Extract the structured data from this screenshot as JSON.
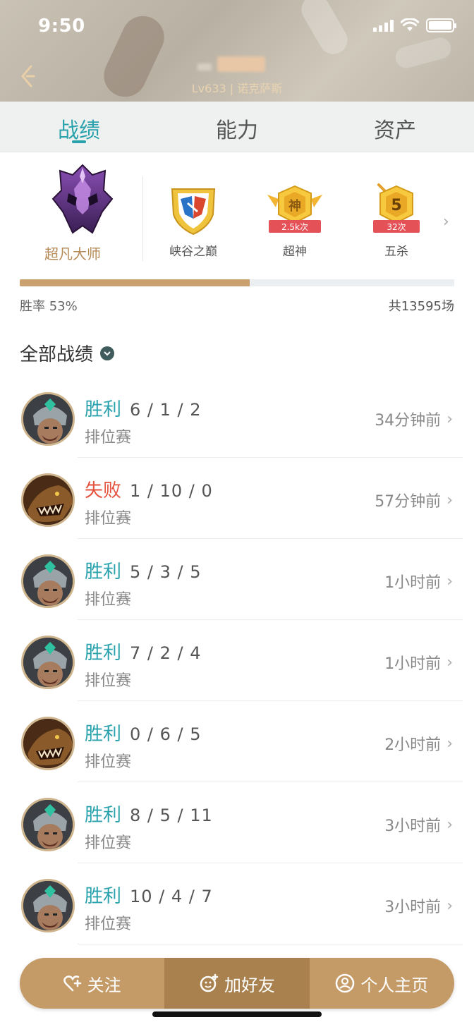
{
  "status_bar": {
    "time": "9:50"
  },
  "header": {
    "subtitle": "Lv633 | 诺克萨斯"
  },
  "tabs": [
    {
      "label": "战绩",
      "active": true
    },
    {
      "label": "能力",
      "active": false
    },
    {
      "label": "资产",
      "active": false
    }
  ],
  "rank": {
    "label": "超凡大师"
  },
  "badges": [
    {
      "label": "峡谷之巅",
      "count": ""
    },
    {
      "label": "超神",
      "count": "2.5k次",
      "glyph": "神"
    },
    {
      "label": "五杀",
      "count": "32次",
      "glyph": "5"
    }
  ],
  "stats": {
    "win_rate_text": "胜率 53%",
    "win_rate": 0.53,
    "total_text": "共13595场"
  },
  "section": {
    "title": "全部战绩"
  },
  "matches": [
    {
      "result": "胜利",
      "outcome": "win",
      "kda": "6 / 1 / 2",
      "mode": "排位赛",
      "time": "34分钟前",
      "champion_icon": "helmeted-warrior"
    },
    {
      "result": "失败",
      "outcome": "lose",
      "kda": "1 / 10 / 0",
      "mode": "排位赛",
      "time": "57分钟前",
      "champion_icon": "beast"
    },
    {
      "result": "胜利",
      "outcome": "win",
      "kda": "5 / 3 / 5",
      "mode": "排位赛",
      "time": "1小时前",
      "champion_icon": "helmeted-warrior"
    },
    {
      "result": "胜利",
      "outcome": "win",
      "kda": "7 / 2 / 4",
      "mode": "排位赛",
      "time": "1小时前",
      "champion_icon": "helmeted-warrior"
    },
    {
      "result": "胜利",
      "outcome": "win",
      "kda": "0 / 6 / 5",
      "mode": "排位赛",
      "time": "2小时前",
      "champion_icon": "beast"
    },
    {
      "result": "胜利",
      "outcome": "win",
      "kda": "8 / 5 / 11",
      "mode": "排位赛",
      "time": "3小时前",
      "champion_icon": "helmeted-warrior"
    },
    {
      "result": "胜利",
      "outcome": "win",
      "kda": "10 / 4 / 7",
      "mode": "排位赛",
      "time": "3小时前",
      "champion_icon": "helmeted-warrior"
    }
  ],
  "actions": {
    "follow": "关注",
    "add_friend": "加好友",
    "profile": "个人主页"
  },
  "colors": {
    "win": "#2aa2ad",
    "lose": "#e4523e",
    "accent_gold": "#c49b67"
  }
}
